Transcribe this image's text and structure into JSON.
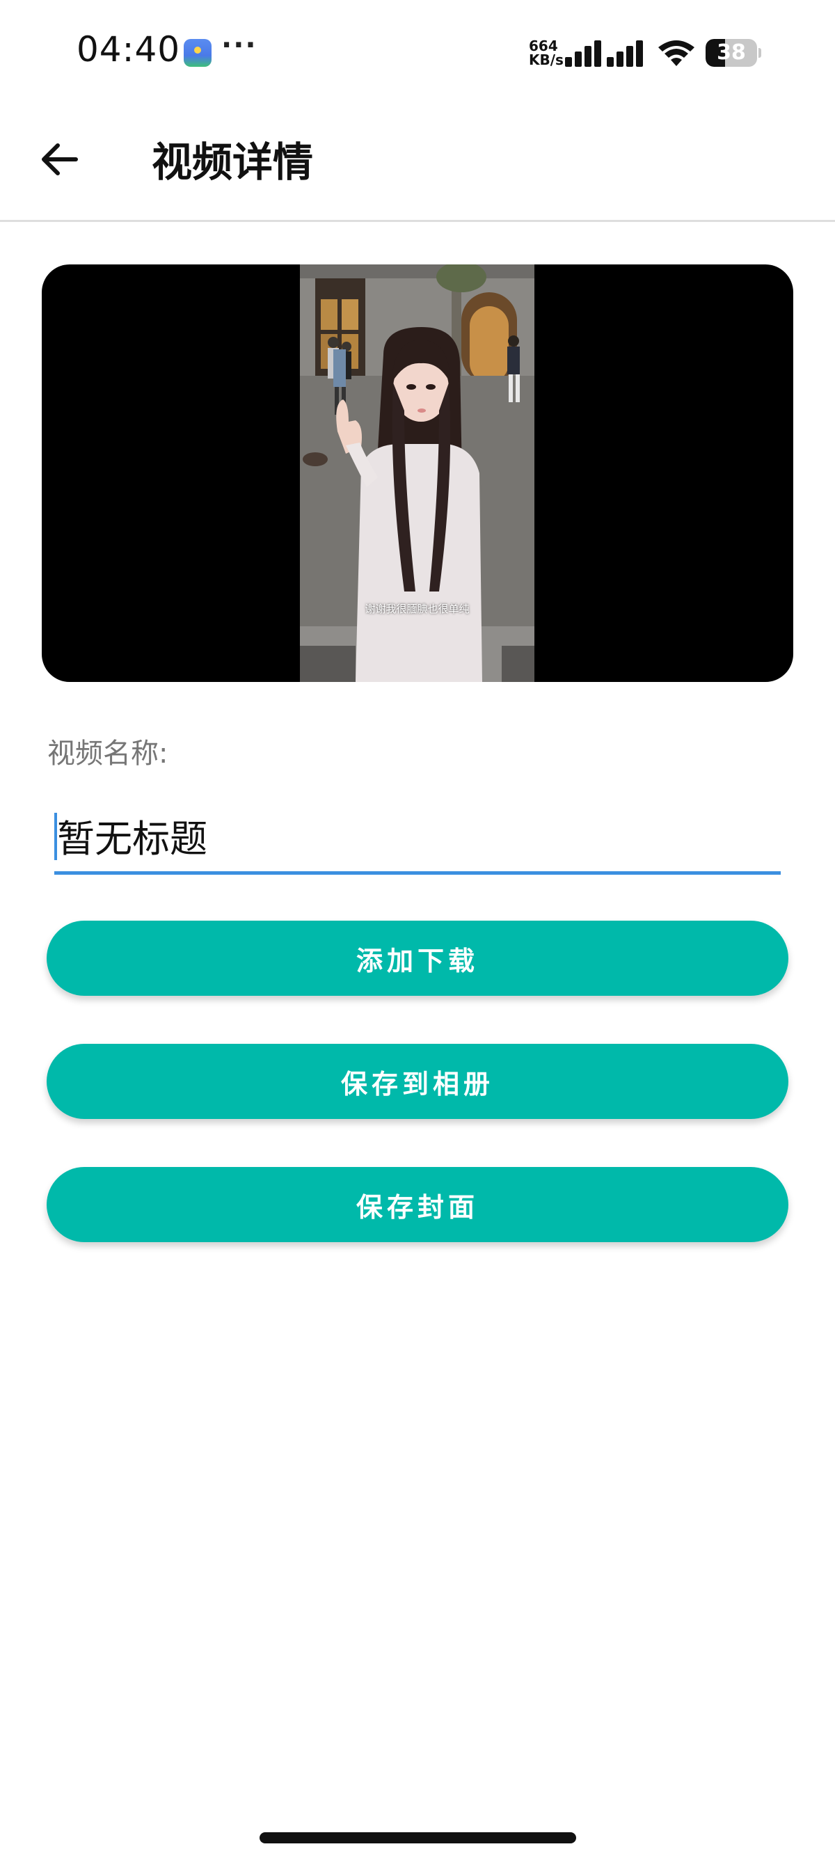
{
  "status_bar": {
    "time": "04:40",
    "more_indicator": "···",
    "net_speed_value": "664",
    "net_speed_unit": "KB/s",
    "battery_level": "38",
    "battery_fraction": 0.38,
    "icons": [
      "app-notification-icon",
      "signal-icon",
      "wifi-icon",
      "battery-icon"
    ]
  },
  "app_bar": {
    "back_icon": "arrow-left-icon",
    "title": "视频详情"
  },
  "video": {
    "subtitle_text": "谢谢我很腼腆也很单纯"
  },
  "form": {
    "name_label": "视频名称:",
    "title_value": "暂无标题"
  },
  "actions": {
    "add_download": "添加下载",
    "save_to_album": "保存到相册",
    "save_cover": "保存封面"
  },
  "colors": {
    "accent": "#00b9aa",
    "input_underline": "#3b8fe0",
    "label_gray": "#767676",
    "divider": "#dedede"
  }
}
